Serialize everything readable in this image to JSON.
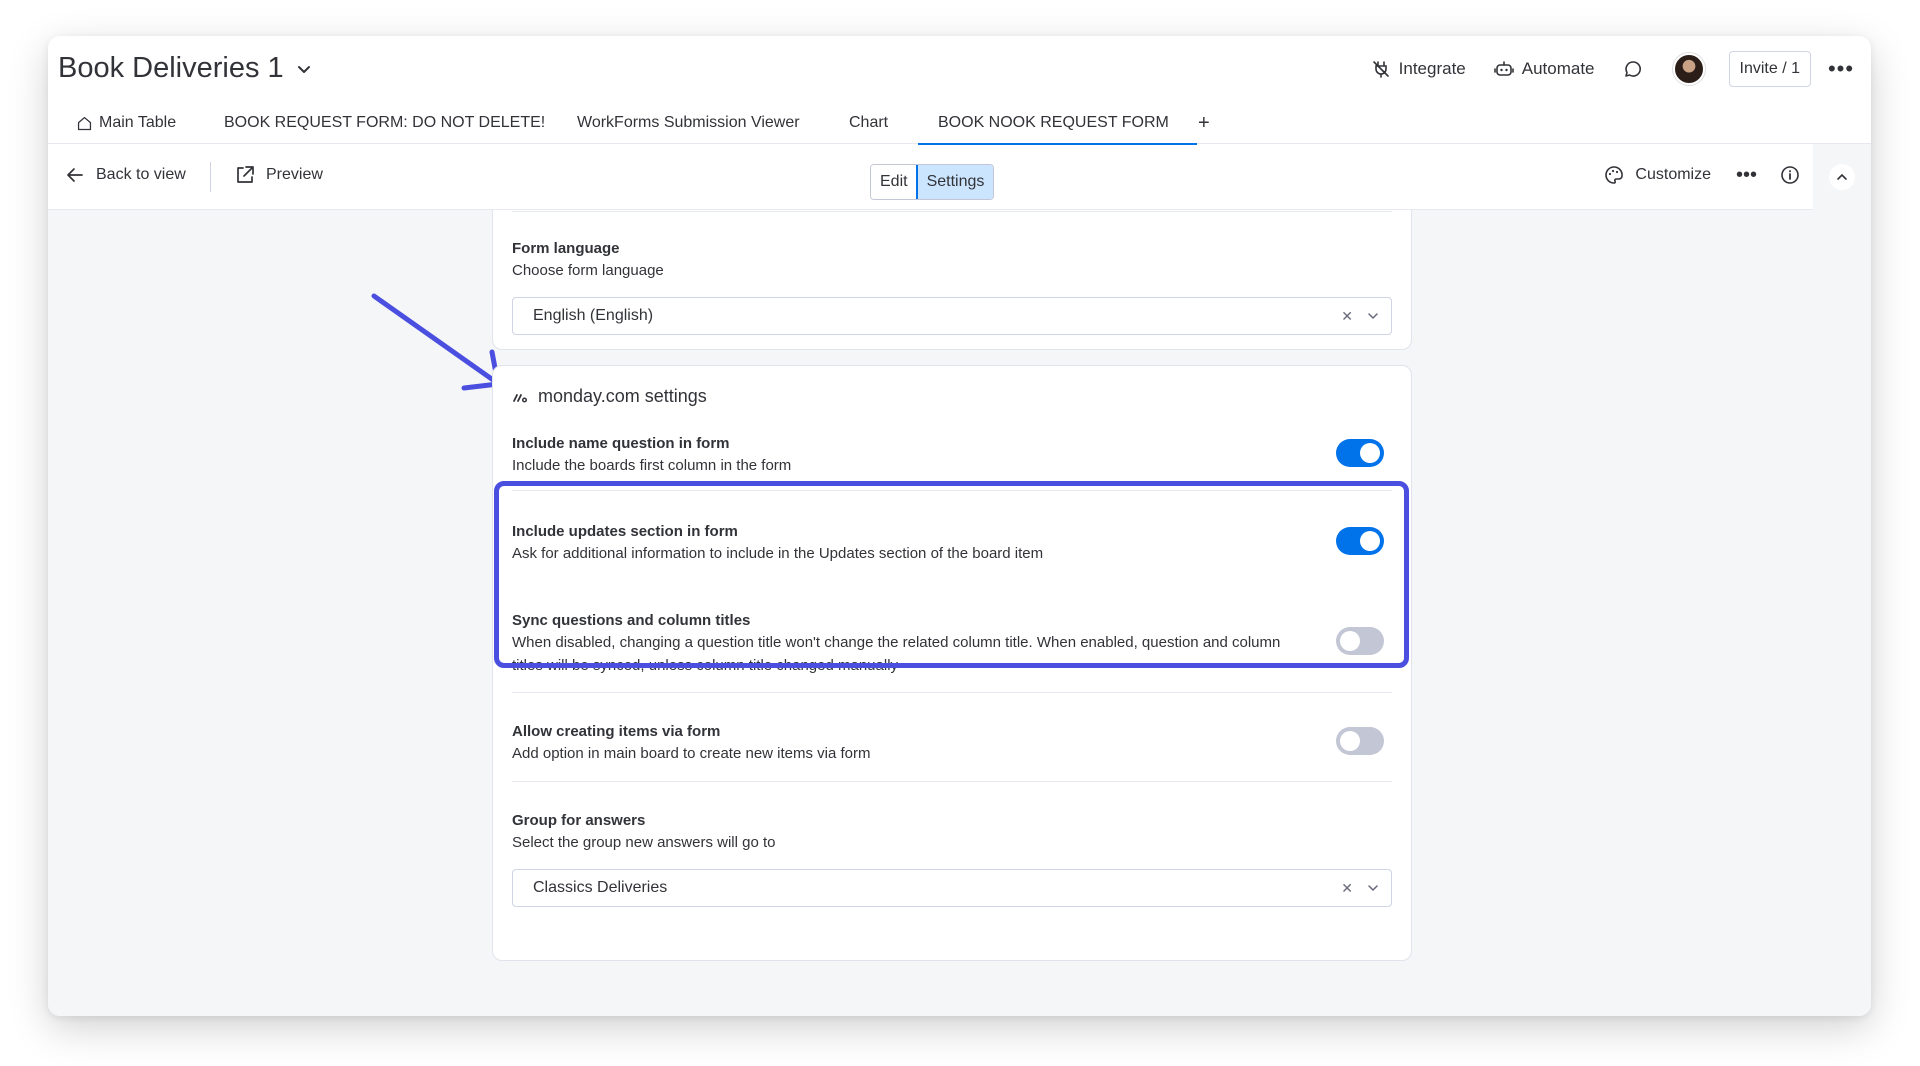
{
  "header": {
    "board_title": "Book Deliveries 1",
    "integrate_label": "Integrate",
    "automate_label": "Automate",
    "invite_label": "Invite / 1"
  },
  "tabs": [
    {
      "label": "Main Table",
      "icon": "home-icon"
    },
    {
      "label": "BOOK REQUEST FORM: DO NOT DELETE!"
    },
    {
      "label": "WorkForms Submission Viewer"
    },
    {
      "label": "Chart"
    },
    {
      "label": "BOOK NOOK REQUEST FORM",
      "active": true
    },
    {
      "label": "+"
    }
  ],
  "toolbar": {
    "back_label": "Back to view",
    "preview_label": "Preview",
    "edit_label": "Edit",
    "settings_label": "Settings",
    "customize_label": "Customize"
  },
  "form_language": {
    "label": "Form language",
    "description": "Choose form language",
    "value": "English (English)"
  },
  "monday_settings": {
    "title": "monday.com settings",
    "settings": [
      {
        "label": "Include name question in form",
        "description": "Include the boards first column in the form",
        "enabled": true
      },
      {
        "label": "Include updates section in form",
        "description": "Ask for additional information to include in the Updates section of the board item",
        "enabled": true
      },
      {
        "label": "Sync questions and column titles",
        "description": "When disabled, changing a question title won't change the related column title. When enabled, question and column titles will be synced, unless column title changed manually",
        "enabled": false
      },
      {
        "label": "Allow creating items via form",
        "description": "Add option in main board to create new items via form",
        "enabled": false
      }
    ],
    "group_for_answers": {
      "label": "Group for answers",
      "description": "Select the group new answers will go to",
      "value": "Classics Deliveries"
    }
  },
  "colors": {
    "accent": "#0073ea",
    "highlight_box": "#4b4fe0",
    "annotation_arrow": "#4b4fe0"
  }
}
